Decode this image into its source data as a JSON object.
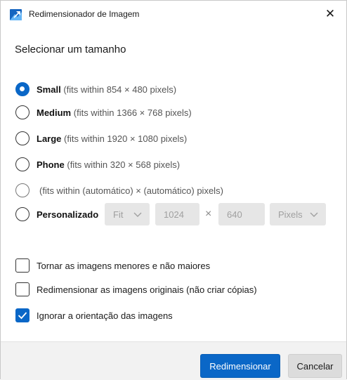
{
  "window": {
    "title": "Redimensionador de Imagem",
    "close_glyph": "✕",
    "app_icon": "image-resizer-icon"
  },
  "heading": "Selecionar um tamanho",
  "size_options": [
    {
      "name": "Small",
      "desc": "(fits within 854 × 480 pixels)",
      "checked": true
    },
    {
      "name": "Medium",
      "desc": "(fits within 1366 × 768 pixels)",
      "checked": false
    },
    {
      "name": "Large",
      "desc": "(fits within 1920 × 1080 pixels)",
      "checked": false
    },
    {
      "name": "Phone",
      "desc": "(fits within 320 × 568 pixels)",
      "checked": false
    },
    {
      "name": "",
      "desc": "(fits within (automático) × (automático) pixels)",
      "checked": false
    },
    {
      "name": "Personalizado",
      "desc": "",
      "checked": false
    }
  ],
  "custom": {
    "fit_value": "Fit",
    "width_value": "1024",
    "times_glyph": "×",
    "height_value": "640",
    "unit_value": "Pixels"
  },
  "checkboxes": [
    {
      "label": "Tornar as imagens menores e não maiores",
      "checked": false
    },
    {
      "label": "Redimensionar as imagens originais (não criar cópias)",
      "checked": false
    },
    {
      "label": "Ignorar a orientação das imagens",
      "checked": true
    }
  ],
  "buttons": {
    "primary": "Redimensionar",
    "secondary": "Cancelar"
  },
  "colors": {
    "accent": "#0a67c7",
    "footer_bg": "#f2f2f2",
    "disabled_field": "#e6e6e6"
  }
}
